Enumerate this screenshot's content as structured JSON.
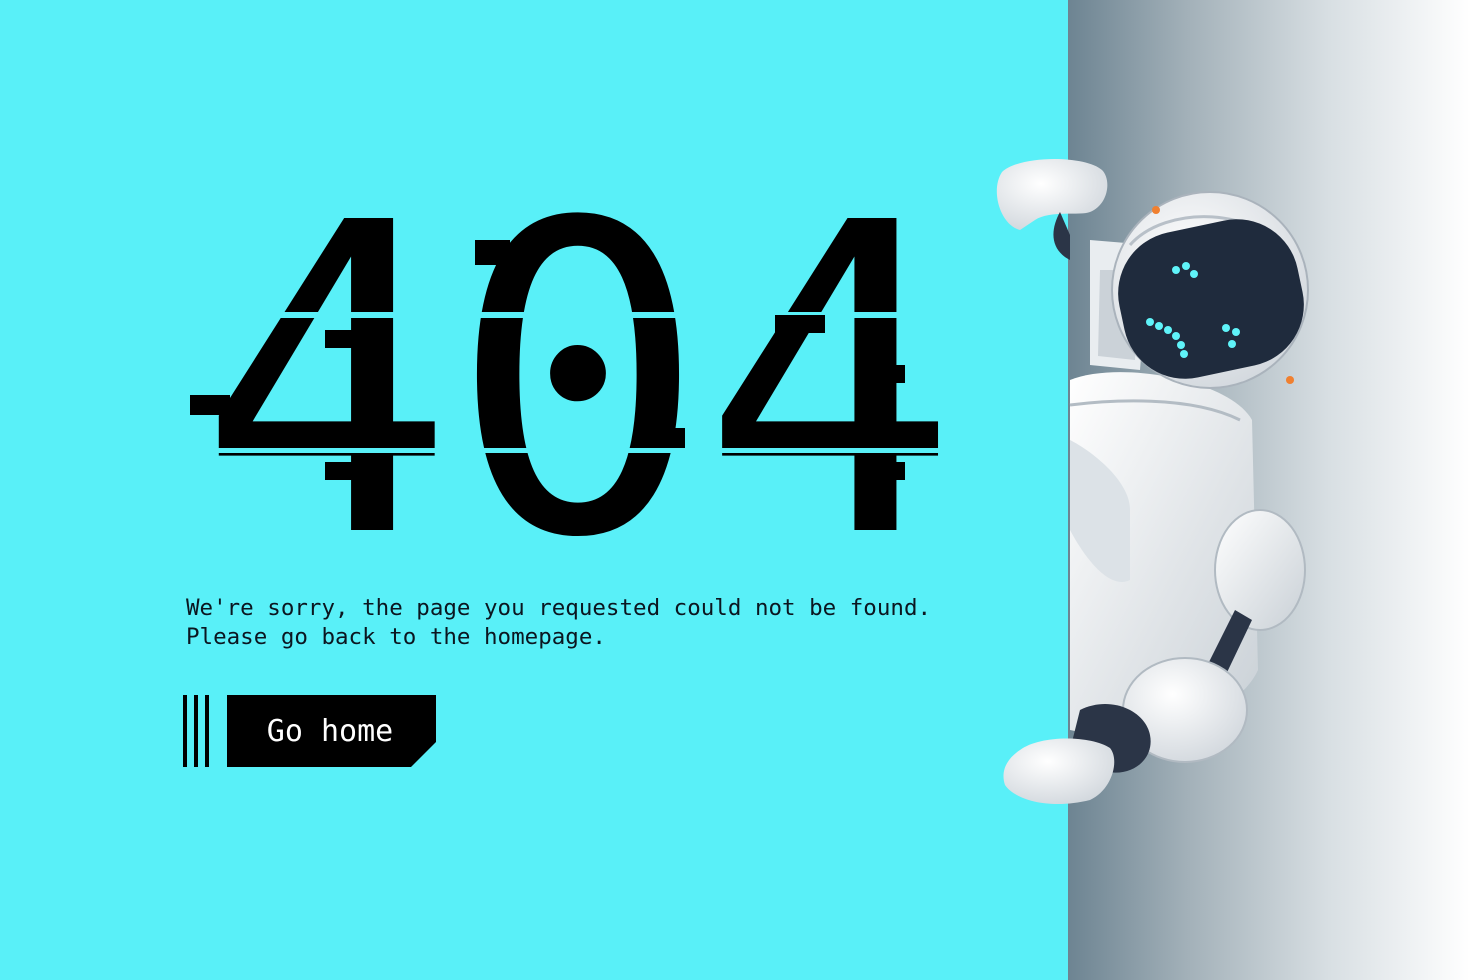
{
  "error": {
    "code": "404",
    "message_line1": "We're sorry, the page you requested could not be found.",
    "message_line2": "Please go back to the homepage."
  },
  "actions": {
    "home_label": "Go home"
  },
  "illustration": {
    "robot_mood": "sad",
    "robot_icon": "robot-peeking-icon"
  },
  "colors": {
    "background": "#59f0f8",
    "text": "#0b1620",
    "button": "#000000",
    "button_text": "#ffffff",
    "robot_face": "#1f2b3d",
    "robot_eyes": "#5ff3f9",
    "robot_body": "#eef1f4"
  }
}
